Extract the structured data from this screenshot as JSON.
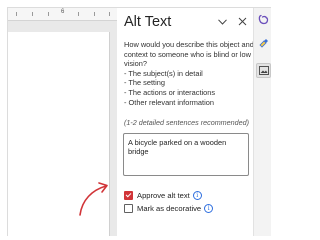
{
  "ruler": {
    "number": "6"
  },
  "pane": {
    "title": "Alt Text",
    "instructions": [
      "How would you describe this object and its",
      "context to someone who is blind or low",
      "vision?",
      "- The subject(s) in detail",
      "- The setting",
      "- The actions or interactions",
      "- Other relevant information"
    ],
    "hint": "(1-2 detailed sentences recommended)",
    "alt_text_value": "A bicycle parked on a wooden bridge",
    "approve_label": "Approve alt text",
    "approve_checked": true,
    "decorative_label": "Mark as decorative",
    "decorative_checked": false,
    "info_glyph": "i"
  },
  "rail": {
    "icons": [
      "copilot-icon",
      "design-icon",
      "alt-text-icon"
    ]
  },
  "colors": {
    "accent_red": "#d13438",
    "info_blue": "#2f6fdf",
    "copilot_purple": "#6b4fbb"
  }
}
